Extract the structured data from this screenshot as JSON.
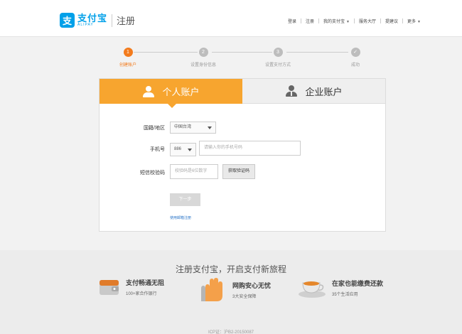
{
  "header": {
    "logo_mark": "支",
    "logo_cn": "支付宝",
    "logo_en": "ALIPAY",
    "page_title": "注册",
    "nav": [
      {
        "label": "登录",
        "dropdown": false
      },
      {
        "label": "注册",
        "dropdown": false
      },
      {
        "label": "我的支付宝",
        "dropdown": true
      },
      {
        "label": "服务大厅",
        "dropdown": false
      },
      {
        "label": "提建议",
        "dropdown": false
      },
      {
        "label": "更多",
        "dropdown": true
      }
    ]
  },
  "steps": [
    {
      "num": "1",
      "label": "创建账户",
      "active": true
    },
    {
      "num": "2",
      "label": "设置身份信息",
      "active": false
    },
    {
      "num": "3",
      "label": "设置支付方式",
      "active": false
    },
    {
      "num": "✓",
      "label": "成功",
      "active": false
    }
  ],
  "tabs": {
    "personal": "个人账户",
    "enterprise": "企业账户"
  },
  "form": {
    "region_label": "国籍/地区",
    "region_value": "中国台湾",
    "phone_label": "手机号",
    "phone_code": "886",
    "phone_placeholder": "请输入你的手机号码",
    "sms_label": "短信校验码",
    "sms_placeholder": "校验码是6位数字",
    "sms_button": "获取验证码",
    "next_button": "下一步",
    "email_link": "使用邮箱注册"
  },
  "footer": {
    "slogan": "注册支付宝，开启支付新旅程",
    "features": [
      {
        "icon": "wallet-icon",
        "title": "支付畅通无阻",
        "subtitle": "100+家合作银行"
      },
      {
        "icon": "hand-icon",
        "title": "网购安心无忧",
        "subtitle": "3大安全保障"
      },
      {
        "icon": "teacup-icon",
        "title": "在家也能缴费还款",
        "subtitle": "35个生活应用"
      }
    ],
    "icp": "ICP证：沪B2-20150087"
  },
  "colors": {
    "brand_blue": "#00a0e9",
    "accent_orange": "#f37b1d",
    "tab_orange": "#f7a52f"
  }
}
